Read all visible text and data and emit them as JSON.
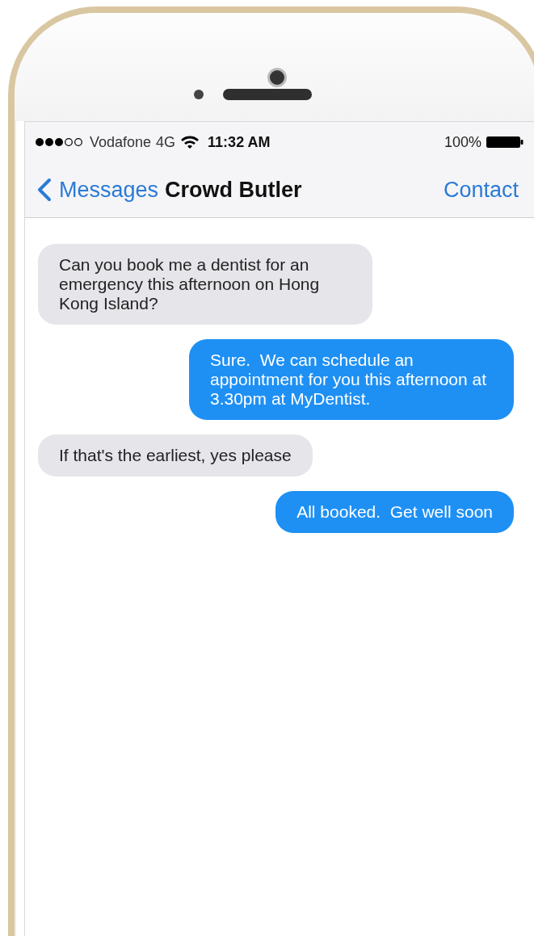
{
  "status_bar": {
    "carrier": "Vodafone",
    "network": "4G",
    "time": "11:32 AM",
    "battery": "100%"
  },
  "nav_bar": {
    "back": "Messages",
    "title": "Crowd Butler",
    "action": "Contact"
  },
  "messages": [
    {
      "kind": "incoming",
      "text": "Can you book me a dentist for an emergency this afternoon on Hong Kong Island?"
    },
    {
      "kind": "outgoing",
      "text": "Sure.  We can schedule an appointment for you this afternoon at 3.30pm at MyDentist."
    },
    {
      "kind": "incoming",
      "text": "If that's the earliest, yes please"
    },
    {
      "kind": "outgoing",
      "text": "All booked.  Get well soon"
    }
  ]
}
